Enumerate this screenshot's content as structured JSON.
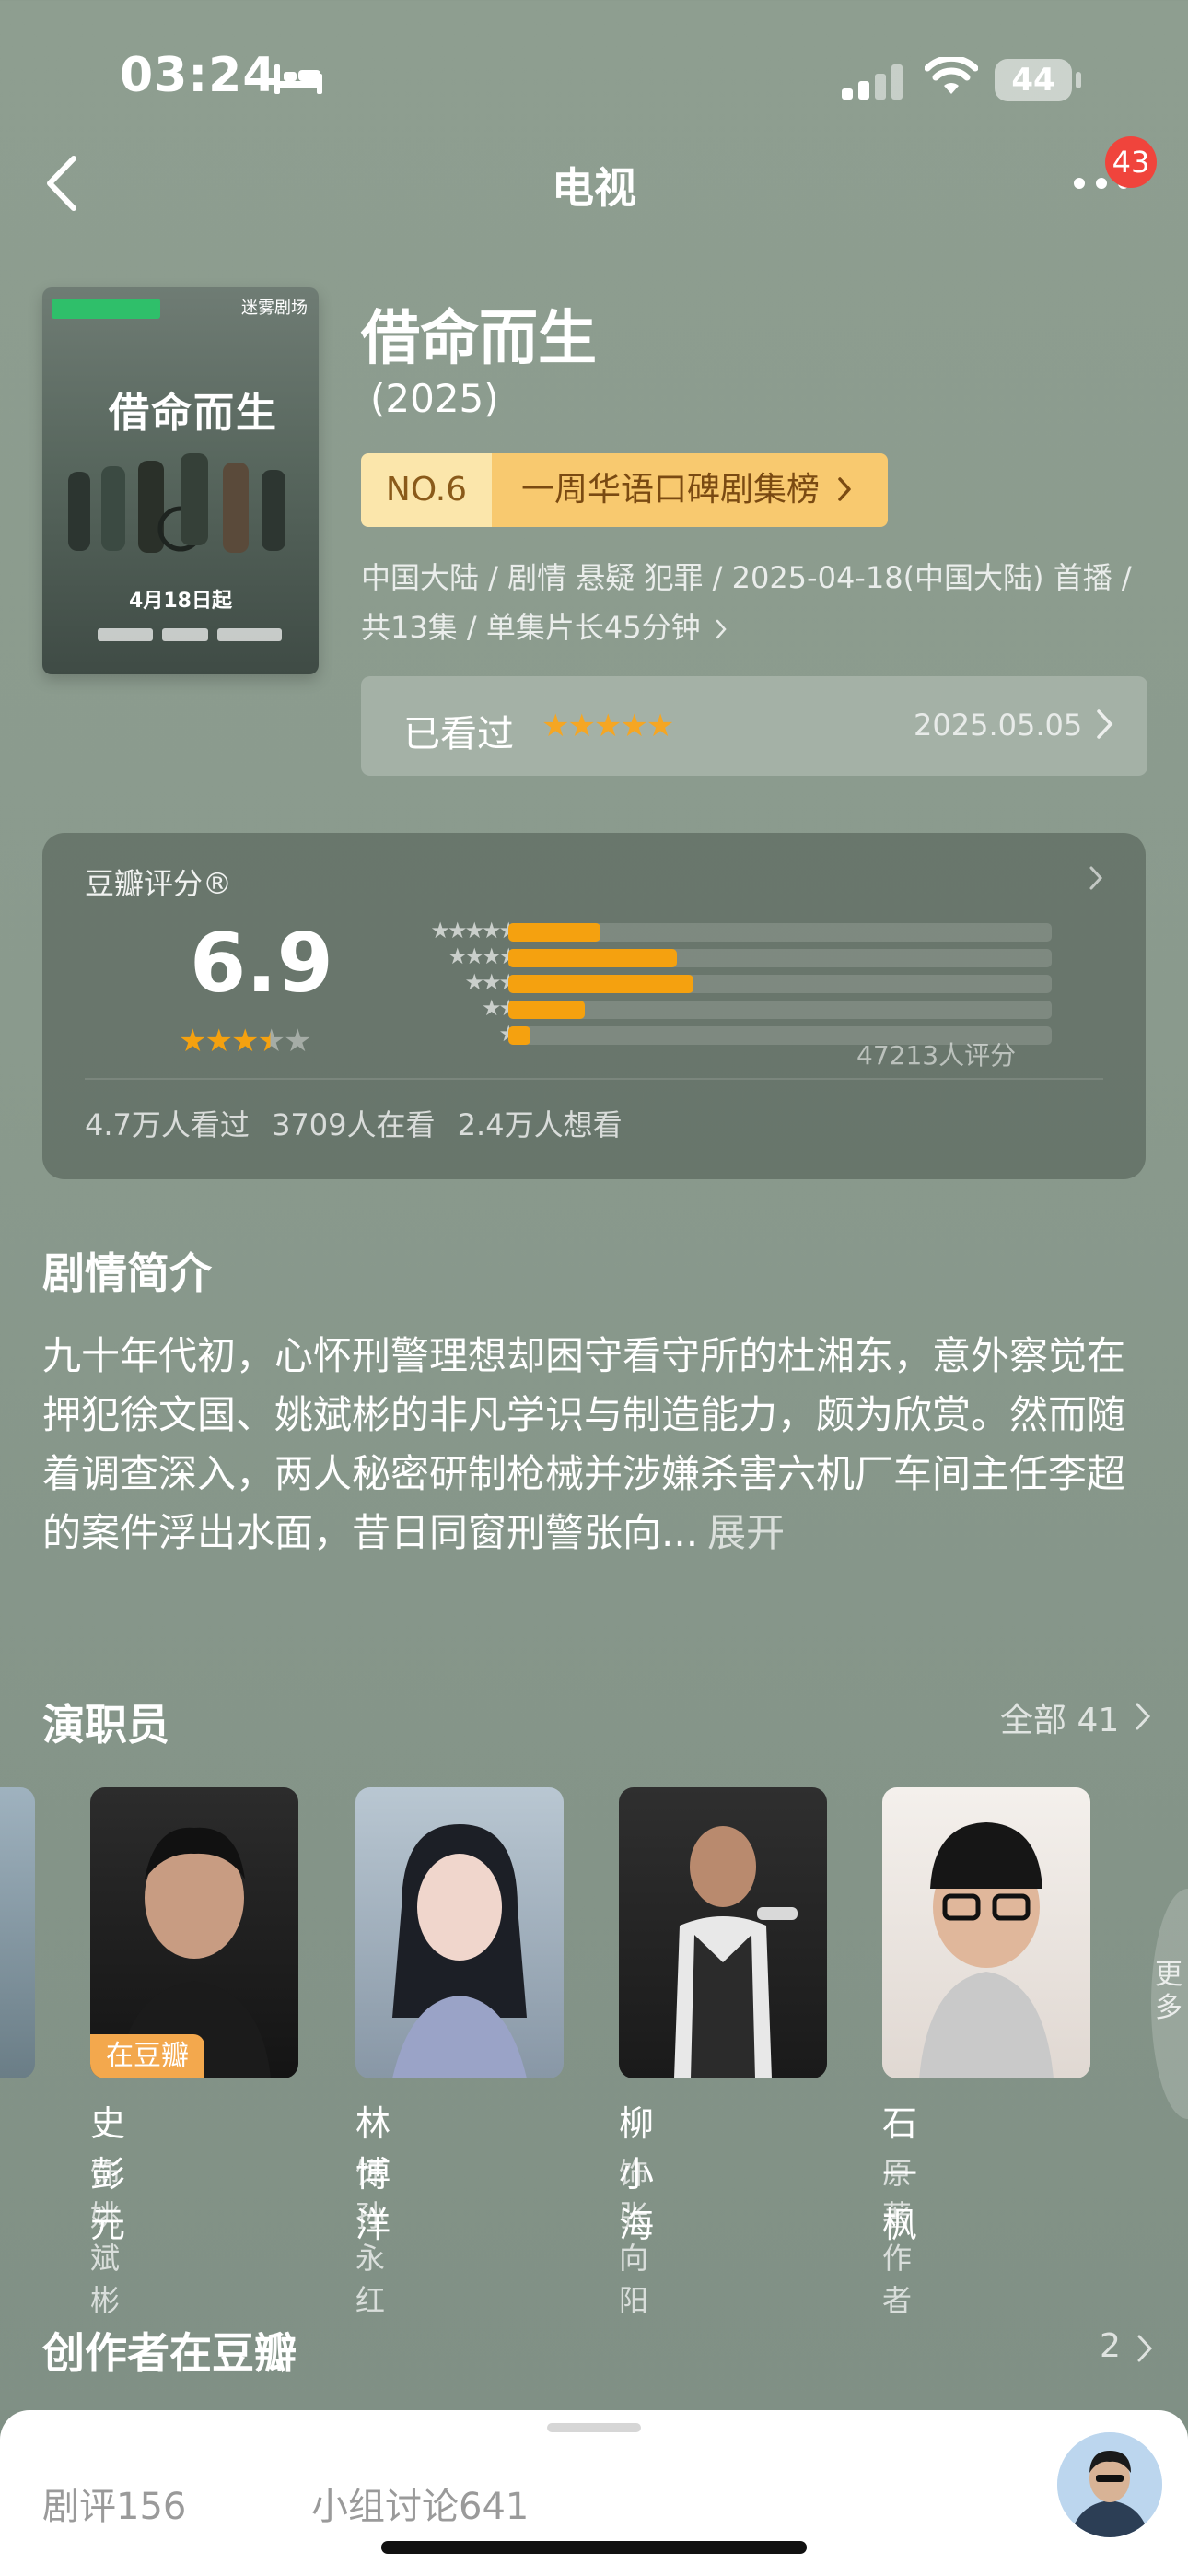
{
  "status_bar": {
    "time": "03:24",
    "battery": "44"
  },
  "nav": {
    "title": "电视",
    "badge": "43"
  },
  "poster": {
    "title": "借命而生",
    "date": "4月18日起",
    "brand": "迷雾剧场"
  },
  "show": {
    "title": "借命而生",
    "year": "(2025)",
    "rank_no": "NO.6",
    "rank_label": "一周华语口碑剧集榜",
    "meta_line1": "中国大陆 / 剧情 悬疑 犯罪 / 2025-04-18(中国大陆) 首播 /",
    "meta_line2": "共13集 / 单集片长45分钟"
  },
  "watched": {
    "label": "已看过",
    "stars": "★★★★★",
    "date": "2025.05.05"
  },
  "rating": {
    "label": "豆瓣评分®",
    "score": "6.9",
    "stars_filled": "★★★",
    "stars_half": "★",
    "stars_empty": "★",
    "count": "47213人评分",
    "distribution": [
      {
        "stars": "★★★★★",
        "fraction": 0.17
      },
      {
        "stars": "★★★★",
        "fraction": 0.31
      },
      {
        "stars": "★★★",
        "fraction": 0.34
      },
      {
        "stars": "★★",
        "fraction": 0.14
      },
      {
        "stars": "★",
        "fraction": 0.04
      }
    ],
    "stats": "4.7万人看过   3709人在看   2.4万人想看"
  },
  "synopsis": {
    "title": "剧情简介",
    "text": "九十年代初，心怀刑警理想却困守看守所的杜湘东，意外察觉在押犯徐文国、姚斌彬的非凡学识与制造能力，颇为欣赏。然而随着调查深入，两人秘密研制枪械并涉嫌杀害六机厂车间主任李超的案件浮出水面，昔日同窗刑警张向...",
    "expand": "展开"
  },
  "cast": {
    "title": "演职员",
    "all": "全部 41",
    "more_tab": "更多",
    "members": [
      {
        "name": "史彭元",
        "role": "饰 姚斌彬",
        "tag": "在豆瓣"
      },
      {
        "name": "林博洋",
        "role": "饰 孙永红"
      },
      {
        "name": "柳小海",
        "role": "饰 张向阳"
      },
      {
        "name": "石一枫",
        "role": "原著作者"
      }
    ]
  },
  "creators": {
    "title": "创作者在豆瓣",
    "count": "2"
  },
  "bottom_tabs": {
    "reviews": "剧评156",
    "groups": "小组讨论641"
  },
  "colors": {
    "accent_star": "#f5a10f",
    "rank_bg": "#f8c96f",
    "badge": "#f0443c",
    "douban_tag": "#f3a84d"
  }
}
